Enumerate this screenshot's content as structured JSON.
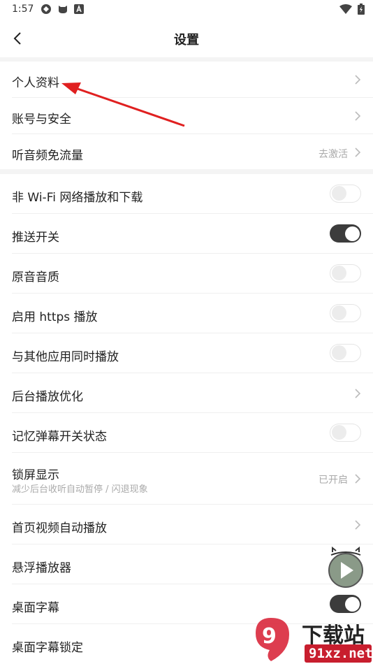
{
  "status_bar": {
    "time": "1:57",
    "left_icons": [
      "vpn-icon",
      "github-icon",
      "notification-a-icon"
    ],
    "right_icons": [
      "wifi-icon",
      "battery-icon"
    ]
  },
  "header": {
    "title": "设置",
    "back_icon": "chevron-left-icon"
  },
  "sections": [
    {
      "rows": [
        {
          "label": "个人资料",
          "control": "chevron"
        },
        {
          "label": "账号与安全",
          "control": "chevron"
        },
        {
          "label": "听音频免流量",
          "control": "chevron",
          "value": "去激活"
        }
      ]
    },
    {
      "rows": [
        {
          "label": "非 Wi-Fi 网络播放和下载",
          "control": "toggle",
          "on": false
        },
        {
          "label": "推送开关",
          "control": "toggle",
          "on": true
        },
        {
          "label": "原音音质",
          "control": "toggle",
          "on": false
        },
        {
          "label": "启用 https 播放",
          "control": "toggle",
          "on": false
        },
        {
          "label": "与其他应用同时播放",
          "control": "toggle",
          "on": false
        },
        {
          "label": "后台播放优化",
          "control": "chevron"
        },
        {
          "label": "记忆弹幕开关状态",
          "control": "toggle",
          "on": false
        },
        {
          "label": "锁屏显示",
          "sublabel": "减少后台收听自动暂停 / 闪退现象",
          "control": "chevron",
          "value": "已开启"
        },
        {
          "label": "首页视频自动播放",
          "control": "chevron"
        },
        {
          "label": "悬浮播放器",
          "control": "none"
        },
        {
          "label": "桌面字幕",
          "control": "toggle",
          "on": true
        },
        {
          "label": "桌面字幕锁定",
          "control": "none"
        }
      ]
    }
  ],
  "floating_player": {
    "icon": "play-icon"
  },
  "watermark": {
    "brand": "下载站",
    "url": "91xz.net",
    "logo_text": "9"
  },
  "annotation": {
    "arrow_color": "#e02020"
  }
}
